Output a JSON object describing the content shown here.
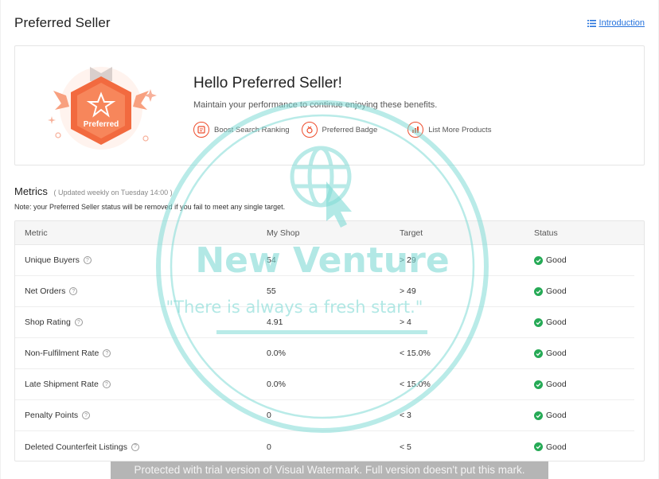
{
  "page": {
    "title": "Preferred Seller",
    "intro_link": "Introduction"
  },
  "hero": {
    "badge_label": "Preferred",
    "title": "Hello Preferred Seller!",
    "subtitle": "Maintain your performance to continue enjoying these benefits.",
    "benefits": [
      {
        "label": "Boost Search Ranking",
        "icon": "search-ranking-icon"
      },
      {
        "label": "Preferred Badge",
        "icon": "badge-icon"
      },
      {
        "label": "List More Products",
        "icon": "products-icon"
      }
    ]
  },
  "metrics": {
    "title": "Metrics",
    "updated": "( Updated weekly on Tuesday 14:00 )",
    "note": "Note: your Preferred Seller status will be removed if you fail to meet any single target.",
    "headers": {
      "metric": "Metric",
      "my_shop": "My Shop",
      "target": "Target",
      "status": "Status"
    },
    "rows": [
      {
        "metric": "Unique Buyers",
        "my_shop": "54",
        "target": "> 29",
        "status": "Good"
      },
      {
        "metric": "Net Orders",
        "my_shop": "55",
        "target": "> 49",
        "status": "Good"
      },
      {
        "metric": "Shop Rating",
        "my_shop": "4.91",
        "target": "> 4",
        "status": "Good"
      },
      {
        "metric": "Non-Fulfilment Rate",
        "my_shop": "0.0%",
        "target": "< 15.0%",
        "status": "Good"
      },
      {
        "metric": "Late Shipment Rate",
        "my_shop": "0.0%",
        "target": "< 15.0%",
        "status": "Good"
      },
      {
        "metric": "Penalty Points",
        "my_shop": "0",
        "target": "< 3",
        "status": "Good"
      },
      {
        "metric": "Deleted Counterfeit Listings",
        "my_shop": "0",
        "target": "< 5",
        "status": "Good"
      }
    ]
  },
  "watermark": {
    "brand": "New Venture",
    "tagline": "\"There is always a fresh start.\"",
    "trial_notice": "Protected with trial version of Visual Watermark. Full version doesn't put this mark."
  },
  "colors": {
    "accent": "#ee4d2d",
    "good": "#26aa56",
    "link": "#2673dd",
    "watermark": "#7fdad5"
  }
}
